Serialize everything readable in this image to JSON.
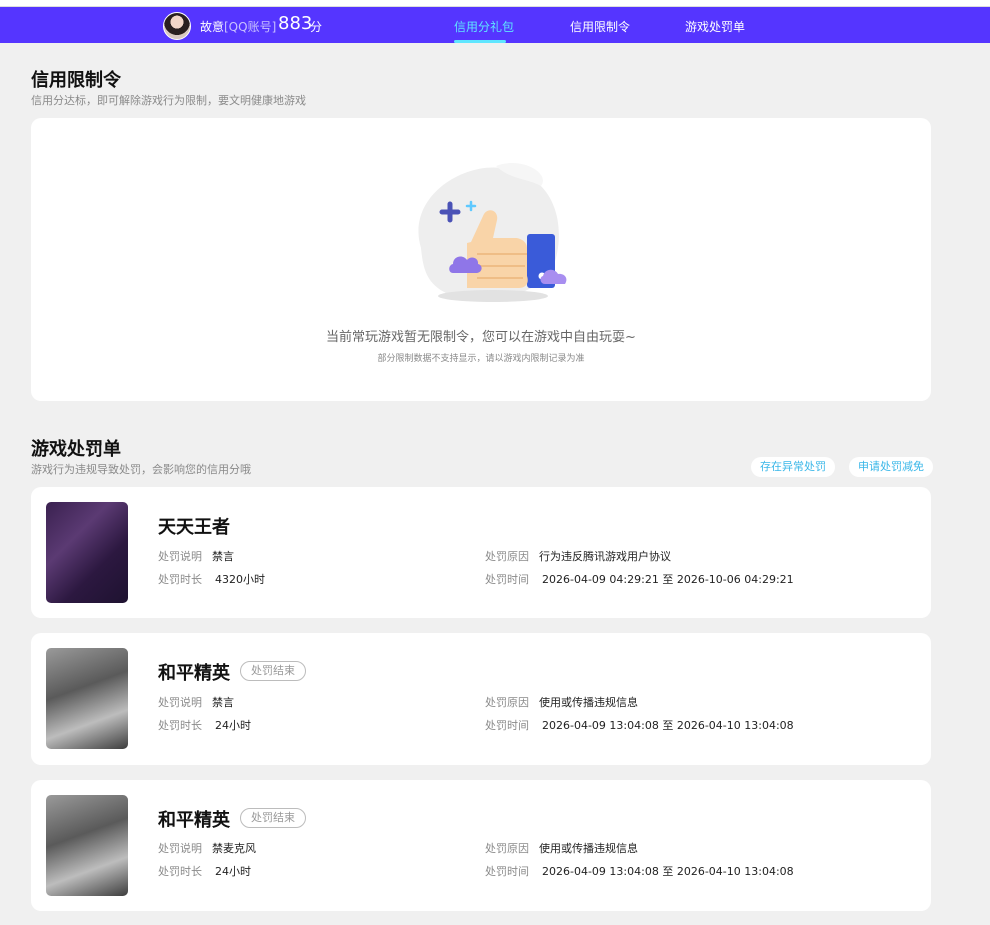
{
  "header": {
    "username": "故意",
    "account_type": "[QQ账号]",
    "score": "883",
    "score_unit": "分",
    "tabs": [
      "信用分礼包",
      "信用限制令",
      "游戏处罚单"
    ],
    "active_tab": "信用分礼包",
    "bg_color": "#5535ff",
    "active_color": "#5fe6ff"
  },
  "restriction": {
    "title": "信用限制令",
    "subtitle": "信用分达标，即可解除游戏行为限制，要文明健康地游戏",
    "empty_message": "当前常玩游戏暂无限制令，您可以在游戏中自由玩耍~",
    "empty_note": "部分限制数据不支持显示，请以游戏内限制记录为准",
    "illustration_icon": "thumbs-up-icon"
  },
  "penalties": {
    "title": "游戏处罚单",
    "subtitle": "游戏行为违规导致处罚，会影响您的信用分哦",
    "buttons": [
      "存在异常处罚",
      "申请处罚减免"
    ],
    "labels": {
      "desc": "处罚说明",
      "duration": "处罚时长",
      "reason": "处罚原因",
      "time": "处罚时间"
    },
    "items": [
      {
        "game": "天天王者",
        "status": "",
        "desc": "禁言",
        "duration": "4320小时",
        "reason": "行为违反腾讯游戏用户协议",
        "time": "2026-04-09 04:29:21 至 2026-10-06 04:29:21"
      },
      {
        "game": "和平精英",
        "status": "处罚结束",
        "desc": "禁言",
        "duration": "24小时",
        "reason": "使用或传播违规信息",
        "time": "2026-04-09 13:04:08 至 2026-04-10 13:04:08"
      },
      {
        "game": "和平精英",
        "status": "处罚结束",
        "desc": "禁麦克风",
        "duration": "24小时",
        "reason": "使用或传播违规信息",
        "time": "2026-04-09 13:04:08 至 2026-04-10 13:04:08"
      }
    ]
  }
}
